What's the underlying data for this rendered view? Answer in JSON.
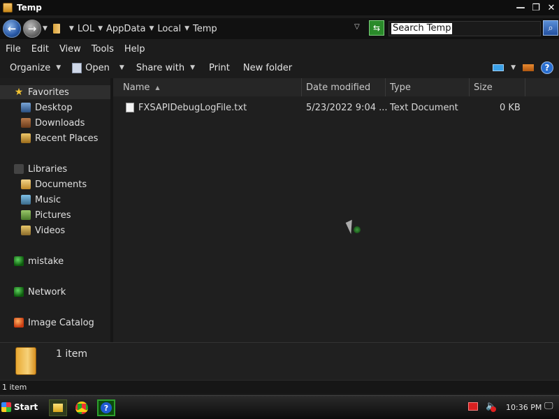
{
  "window": {
    "title": "Temp",
    "controls": {
      "minimize": "—",
      "restore": "❐",
      "close": "✕"
    }
  },
  "address": {
    "crumbs": [
      "LOL",
      "AppData",
      "Local",
      "Temp"
    ],
    "search_placeholder": "Search Temp"
  },
  "menu": [
    "File",
    "Edit",
    "View",
    "Tools",
    "Help"
  ],
  "toolbar": {
    "organize": "Organize",
    "open": "Open",
    "share_with": "Share with",
    "print": "Print",
    "new_folder": "New folder"
  },
  "nav": {
    "favorites": "Favorites",
    "desktop": "Desktop",
    "downloads": "Downloads",
    "recent_places": "Recent Places",
    "libraries": "Libraries",
    "documents": "Documents",
    "music": "Music",
    "pictures": "Pictures",
    "videos": "Videos",
    "mistake": "mistake",
    "network": "Network",
    "image_catalog": "Image Catalog"
  },
  "columns": {
    "name": "Name",
    "date_modified": "Date modified",
    "type": "Type",
    "size": "Size"
  },
  "files": [
    {
      "name": "FXSAPIDebugLogFile.txt",
      "date_modified": "5/23/2022 9:04 ...",
      "type": "Text Document",
      "size": "0 KB"
    }
  ],
  "details": {
    "count": "1 item"
  },
  "status": {
    "count": "1 item"
  },
  "taskbar": {
    "start": "Start",
    "help_glyph": "?",
    "clock": "10:36 PM"
  }
}
